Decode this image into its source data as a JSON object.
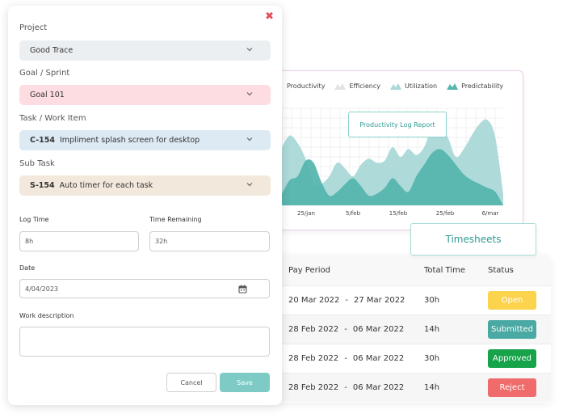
{
  "form": {
    "project": {
      "label": "Project",
      "value": "Good Trace",
      "bg": "#eceff1"
    },
    "goal": {
      "label": "Goal / Sprint",
      "value": "Goal 101",
      "bg": "#fddde2"
    },
    "task": {
      "label": "Task / Work Item",
      "code": "C-154",
      "value": "Impliment splash screen for desktop",
      "bg": "#ddeaf3"
    },
    "subtask": {
      "label": "Sub Task",
      "code": "S-154",
      "value": "Auto timer for each task",
      "bg": "#f2e8dc"
    },
    "log_time": {
      "label": "Log Time",
      "value": "8h"
    },
    "time_remaining": {
      "label": "Time Remaining",
      "value": "32h"
    },
    "date": {
      "label": "Date",
      "value": "4/04/2023"
    },
    "work_description": {
      "label": "Work description",
      "value": ""
    },
    "cancel_label": "Cancel",
    "save_label": "Save",
    "close_glyph": "✖",
    "accent": "#7ecbc6"
  },
  "chart_data": {
    "type": "area",
    "title": "Productivity Log Report",
    "legend": [
      "Productivity",
      "Efficiency",
      "Utilization",
      "Predictability"
    ],
    "x_labels": [
      "25/jan",
      "5/feb",
      "15/feb",
      "25/feb",
      "6/mar"
    ],
    "series": [
      {
        "name": "Utilization",
        "color": "#aad9d8",
        "values": [
          60,
          72,
          64,
          48,
          22,
          22,
          30,
          44,
          38,
          30,
          42,
          48,
          44,
          46,
          60,
          50,
          58,
          52,
          60,
          80,
          84,
          70,
          50,
          58,
          72,
          84,
          88,
          70,
          12
        ]
      },
      {
        "name": "Predictability",
        "color": "#55b6af",
        "values": [
          12,
          26,
          30,
          46,
          44,
          24,
          10,
          14,
          22,
          28,
          20,
          10,
          12,
          18,
          28,
          20,
          14,
          30,
          42,
          54,
          58,
          52,
          42,
          32,
          26,
          22,
          18,
          14,
          0
        ]
      }
    ],
    "ylim": [
      0,
      100
    ],
    "grid": true
  },
  "timesheet": {
    "tab_label": "Timesheets",
    "headers": [
      "Pay Period",
      "Total Time",
      "Status"
    ],
    "rows": [
      {
        "from": "20  Mar 2022",
        "to": "27  Mar 2022",
        "total": "30h",
        "status": "Open",
        "color": "#fcd34d",
        "text_color": "#ffffff"
      },
      {
        "from": "28  Feb 2022",
        "to": "06  Mar 2022",
        "total": "14h",
        "status": "Submitted",
        "color": "#4aa9a2",
        "text_color": "#ffffff"
      },
      {
        "from": "28  Feb 2022",
        "to": "06  Mar 2022",
        "total": "30h",
        "status": "Approved",
        "color": "#16a34a",
        "text_color": "#ffffff"
      },
      {
        "from": "28  Feb 2022",
        "to": "06  Mar 2022",
        "total": "14h",
        "status": "Reject",
        "color": "#f06b6b",
        "text_color": "#ffffff"
      }
    ],
    "separator": "-"
  }
}
